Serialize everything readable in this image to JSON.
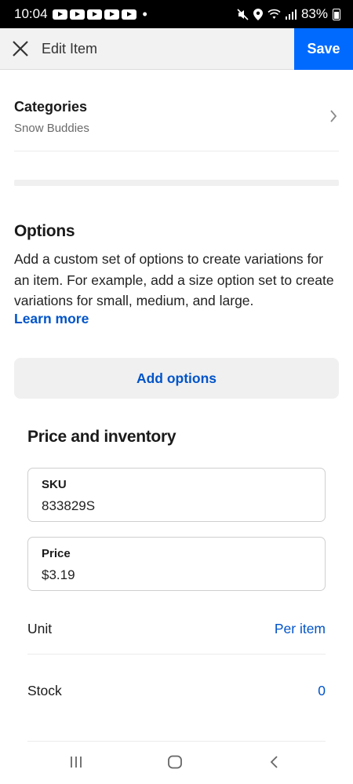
{
  "status_bar": {
    "time": "10:04",
    "dot": "•",
    "battery": "83%",
    "icons": [
      "youtube-icon",
      "youtube-icon",
      "youtube-icon",
      "youtube-icon",
      "youtube-icon",
      "mute-icon",
      "location-icon",
      "wifi-icon",
      "signal-icon",
      "battery-icon"
    ]
  },
  "header": {
    "title": "Edit Item",
    "save_label": "Save"
  },
  "categories": {
    "title": "Categories",
    "value": "Snow Buddies"
  },
  "options": {
    "title": "Options",
    "description": "Add a custom set of options to create variations for an item. For example, add a size option set to create variations for small, medium, and large.",
    "learn_more": "Learn more",
    "add_button": "Add options"
  },
  "price_inventory": {
    "title": "Price and inventory",
    "sku_label": "SKU",
    "sku_value": "833829S",
    "price_label": "Price",
    "price_value": "$3.19",
    "unit_label": "Unit",
    "unit_value": "Per item",
    "stock_label": "Stock",
    "stock_value": "0"
  },
  "colors": {
    "accent": "#006aff",
    "link": "#0054c9"
  }
}
